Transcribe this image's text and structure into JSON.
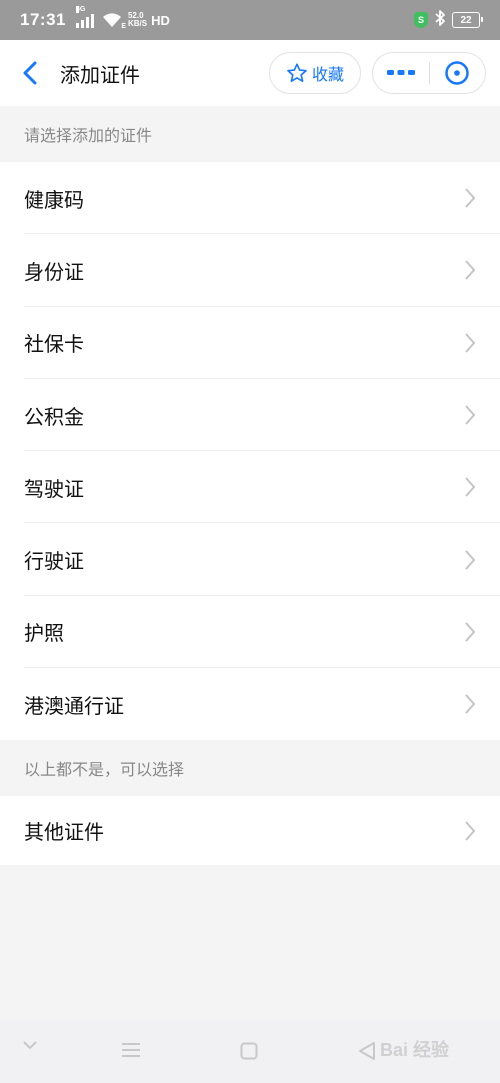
{
  "status_bar": {
    "time": "17:31",
    "network": "4G",
    "speed_value": "52.0",
    "speed_unit": "KB/S",
    "hd": "HD",
    "wifi_type": "E",
    "vpn_badge": "S",
    "battery": "22"
  },
  "nav": {
    "title": "添加证件",
    "favorite_label": "收藏",
    "accent_color": "#1677ff"
  },
  "section1": {
    "header": "请选择添加的证件",
    "items": [
      {
        "label": "健康码"
      },
      {
        "label": "身份证"
      },
      {
        "label": "社保卡"
      },
      {
        "label": "公积金"
      },
      {
        "label": "驾驶证"
      },
      {
        "label": "行驶证"
      },
      {
        "label": "护照"
      },
      {
        "label": "港澳通行证"
      }
    ]
  },
  "section2": {
    "header": "以上都不是，可以选择",
    "items": [
      {
        "label": "其他证件"
      }
    ]
  },
  "watermark": "Bai 经验"
}
